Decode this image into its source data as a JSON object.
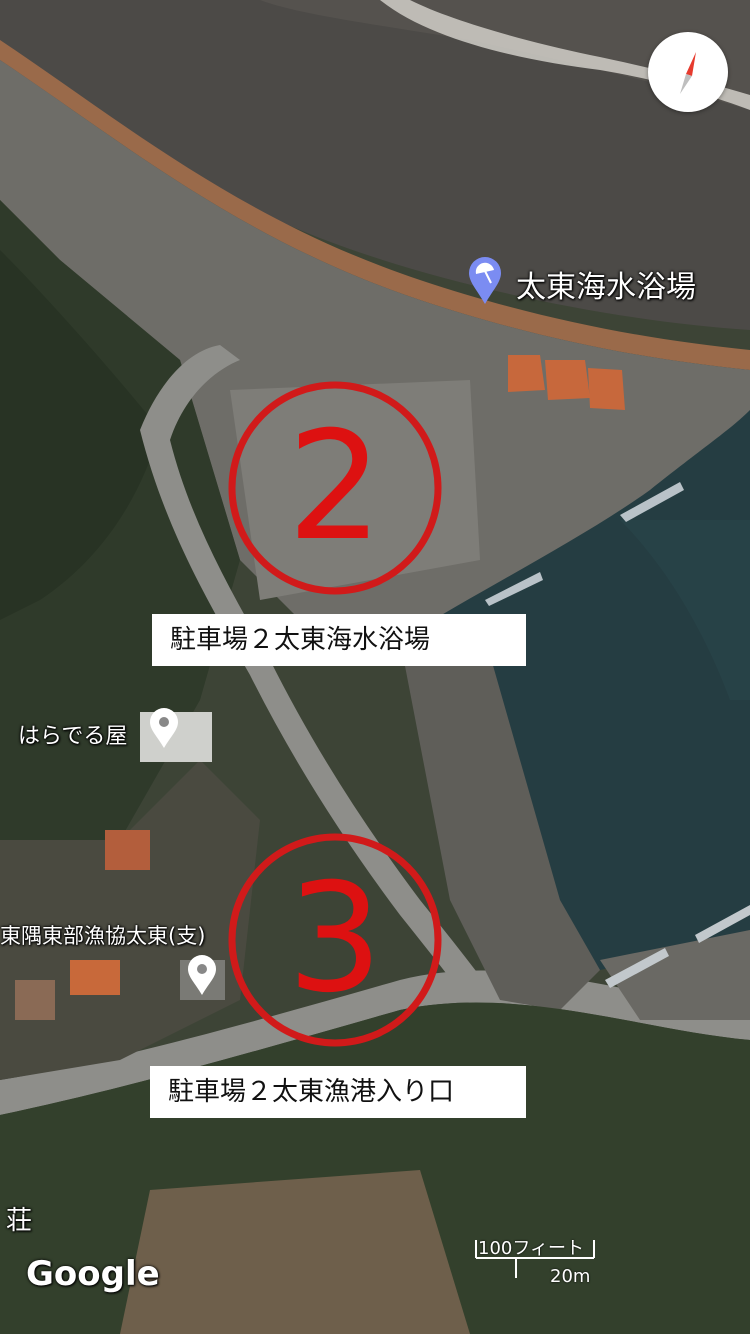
{
  "map": {
    "beach_label": "太東海水浴場",
    "poi_haraderu": "はらでる屋",
    "poi_fishery": "東隅東部漁協太東(支)",
    "poi_so": "荘",
    "annotation_2": {
      "number": "2",
      "caption": "駐車場２太東海水浴場"
    },
    "annotation_3": {
      "number": "3",
      "caption": "駐車場２太東漁港入り口"
    },
    "attribution": "Google",
    "scale": {
      "imperial": "100フィート",
      "metric": "20m"
    },
    "colors": {
      "annotation": "#d11a1a",
      "beach_pin": "#7b8cf2",
      "poi_pin": "#ffffff"
    },
    "icons": {
      "compass": "compass-icon",
      "beach_pin": "beach-umbrella-pin-icon",
      "poi_pin": "location-pin-icon"
    }
  }
}
